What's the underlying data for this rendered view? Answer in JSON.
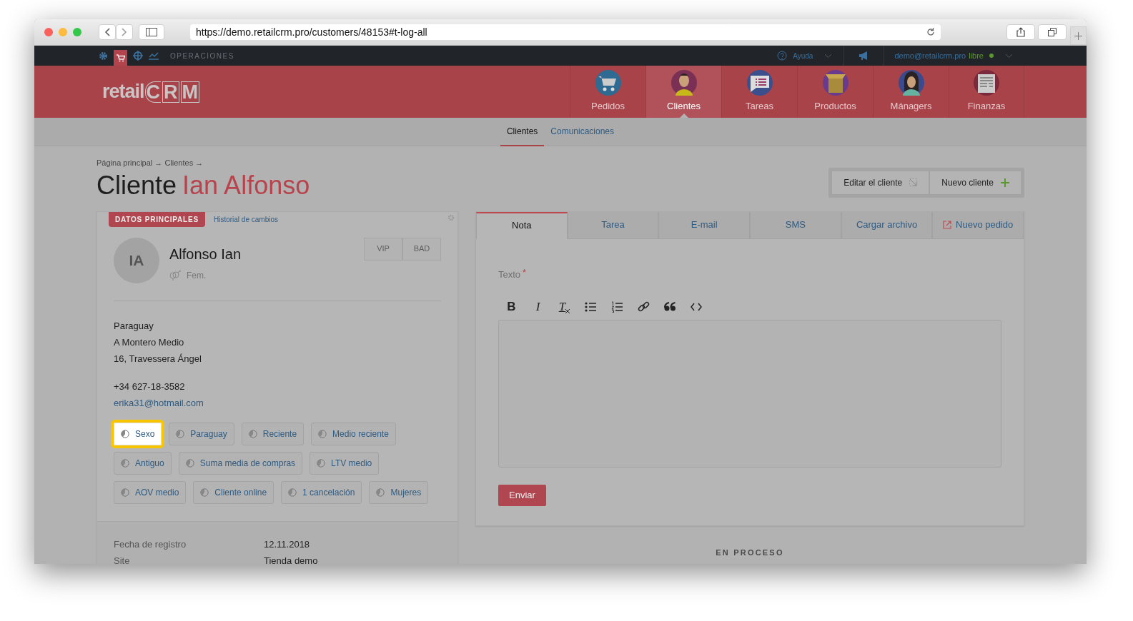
{
  "browser": {
    "url": "https://demo.retailcrm.pro/customers/48153#t-log-all"
  },
  "topbar": {
    "section": "OPERACIONES",
    "help": "Ayuda",
    "user_email": "demo@retailcrm.pro",
    "plan": "libre"
  },
  "logo": {
    "prefix": "retail",
    "letters": [
      "C",
      "R",
      "M"
    ]
  },
  "main_nav": [
    {
      "label": "Pedidos",
      "selected": false
    },
    {
      "label": "Clientes",
      "selected": true
    },
    {
      "label": "Tareas",
      "selected": false
    },
    {
      "label": "Productos",
      "selected": false
    },
    {
      "label": "Mánagers",
      "selected": false
    },
    {
      "label": "Finanzas",
      "selected": false
    }
  ],
  "sub_nav": [
    {
      "label": "Clientes",
      "selected": true
    },
    {
      "label": "Comunicaciones",
      "selected": false
    }
  ],
  "breadcrumb": "Página principal → Clientes →",
  "title": {
    "prefix": "Cliente",
    "name": "Ian Alfonso"
  },
  "actions": [
    "Editar el cliente",
    "Nuevo cliente"
  ],
  "customer_card": {
    "tabs": [
      {
        "label": "DATOS PRINCIPALES",
        "selected": true
      },
      {
        "label": "Historial de cambios",
        "selected": false
      }
    ],
    "initials": "IA",
    "name": "Alfonso Ian",
    "gender": "Fem.",
    "flags": [
      "VIP",
      "BAD"
    ],
    "address": [
      "Paraguay",
      "A Montero Medio",
      "16, Travessera Ángel"
    ],
    "phone": "+34 627-18-3582",
    "email": "erika31@hotmail.com",
    "segments": [
      {
        "label": "Sexo",
        "highlighted": true
      },
      {
        "label": "Paraguay",
        "highlighted": false
      },
      {
        "label": "Reciente",
        "highlighted": false
      },
      {
        "label": "Medio reciente",
        "highlighted": false
      },
      {
        "label": "Antiguo",
        "highlighted": false
      },
      {
        "label": "Suma media de compras",
        "highlighted": false
      },
      {
        "label": "LTV medio",
        "highlighted": false
      },
      {
        "label": "AOV medio",
        "highlighted": false
      },
      {
        "label": "Cliente online",
        "highlighted": false
      },
      {
        "label": "1 cancelación",
        "highlighted": false
      },
      {
        "label": "Mujeres",
        "highlighted": false
      }
    ],
    "details": [
      {
        "label": "Fecha de registro",
        "value": "12.11.2018"
      },
      {
        "label": "Site",
        "value": "Tienda demo"
      }
    ]
  },
  "composer": {
    "tabs": [
      {
        "label": "Nota",
        "selected": true
      },
      {
        "label": "Tarea",
        "selected": false
      },
      {
        "label": "E-mail",
        "selected": false
      },
      {
        "label": "SMS",
        "selected": false
      },
      {
        "label": "Cargar archivo",
        "selected": false
      },
      {
        "label": "Nuevo pedido",
        "selected": false
      }
    ],
    "field_label": "Texto",
    "required_mark": "*",
    "toolbar": [
      {
        "kind": "bold",
        "label": "B"
      },
      {
        "kind": "italic",
        "label": "I"
      },
      {
        "kind": "clear",
        "label": "T"
      },
      {
        "kind": "bullets"
      },
      {
        "kind": "numbers"
      },
      {
        "kind": "link"
      },
      {
        "kind": "quote"
      },
      {
        "kind": "code"
      }
    ],
    "submit": "Enviar"
  },
  "section_heading": "EN PROCESO"
}
